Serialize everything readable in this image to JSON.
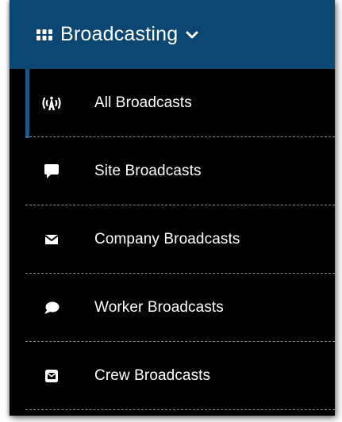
{
  "menu": {
    "title": "Broadcasting",
    "title_icon": "grid-icon",
    "expand_icon": "chevron-down-icon",
    "colors": {
      "header_bg": "#0c4672",
      "panel_bg": "#000000",
      "active_indicator": "#155a8a",
      "text": "#ffffff"
    },
    "items": [
      {
        "label": "All Broadcasts",
        "icon": "broadcast-tower-icon",
        "active": true
      },
      {
        "label": "Site Broadcasts",
        "icon": "speech-bubble-square-icon",
        "active": false
      },
      {
        "label": "Company Broadcasts",
        "icon": "envelope-icon",
        "active": false
      },
      {
        "label": "Worker Broadcasts",
        "icon": "speech-bubble-round-icon",
        "active": false
      },
      {
        "label": "Crew Broadcasts",
        "icon": "envelope-square-icon",
        "active": false
      }
    ]
  }
}
